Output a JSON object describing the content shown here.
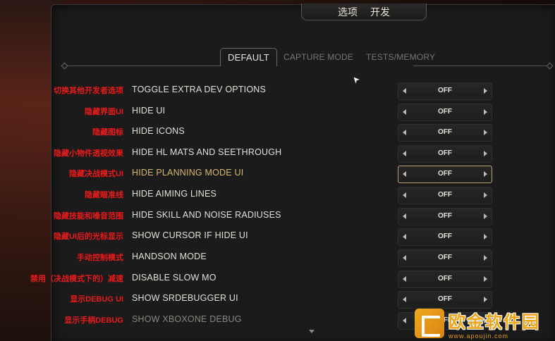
{
  "header": {
    "left": "选项",
    "right": "开发"
  },
  "tabs": [
    "DEFAULT",
    "CAPTURE MODE",
    "TESTS/MEMORY"
  ],
  "rows": [
    {
      "cn": "切换其他开发者选项",
      "en": "TOGGLE EXTRA DEV OPTIONS",
      "value": "OFF"
    },
    {
      "cn": "隐藏界面UI",
      "en": "HIDE UI",
      "value": "OFF"
    },
    {
      "cn": "隐藏图标",
      "en": "HIDE ICONS",
      "value": "OFF"
    },
    {
      "cn": "隐藏小物件透视效果",
      "en": "HIDE HL MATS AND SEETHROUGH",
      "value": "OFF"
    },
    {
      "cn": "隐藏决战模式UI",
      "en": "HIDE PLANNING MODE UI",
      "value": "OFF"
    },
    {
      "cn": "隐藏瞄准线",
      "en": "HIDE AIMING LINES",
      "value": "OFF"
    },
    {
      "cn": "隐藏技能和噪音范围",
      "en": "HIDE SKILL AND NOISE RADIUSES",
      "value": "OFF"
    },
    {
      "cn": "隐藏UI后的光标显示",
      "en": "SHOW CURSOR IF HIDE UI",
      "value": "OFF"
    },
    {
      "cn": "手动控制模式",
      "en": "HANDSON MODE",
      "value": "OFF"
    },
    {
      "cn": "禁用（决战模式下的）减速",
      "en": "DISABLE SLOW MO",
      "value": "OFF"
    },
    {
      "cn": "显示DEBUG UI",
      "en": "SHOW SRDEBUGGER UI",
      "value": "OFF"
    },
    {
      "cn": "显示手柄DEBUG",
      "en": "SHOW XBOXONE DEBUG",
      "value": "OFF"
    }
  ],
  "watermark": {
    "title": "欧金软件园",
    "url": "www.apoujin.com"
  },
  "colors": {
    "annotation": "#e02020",
    "highlight": "#d8b86a",
    "text": "#e4e0d8"
  },
  "icons": [
    "mouse-cursor-icon",
    "left-arrow-icon",
    "right-arrow-icon",
    "scroll-down-icon"
  ]
}
